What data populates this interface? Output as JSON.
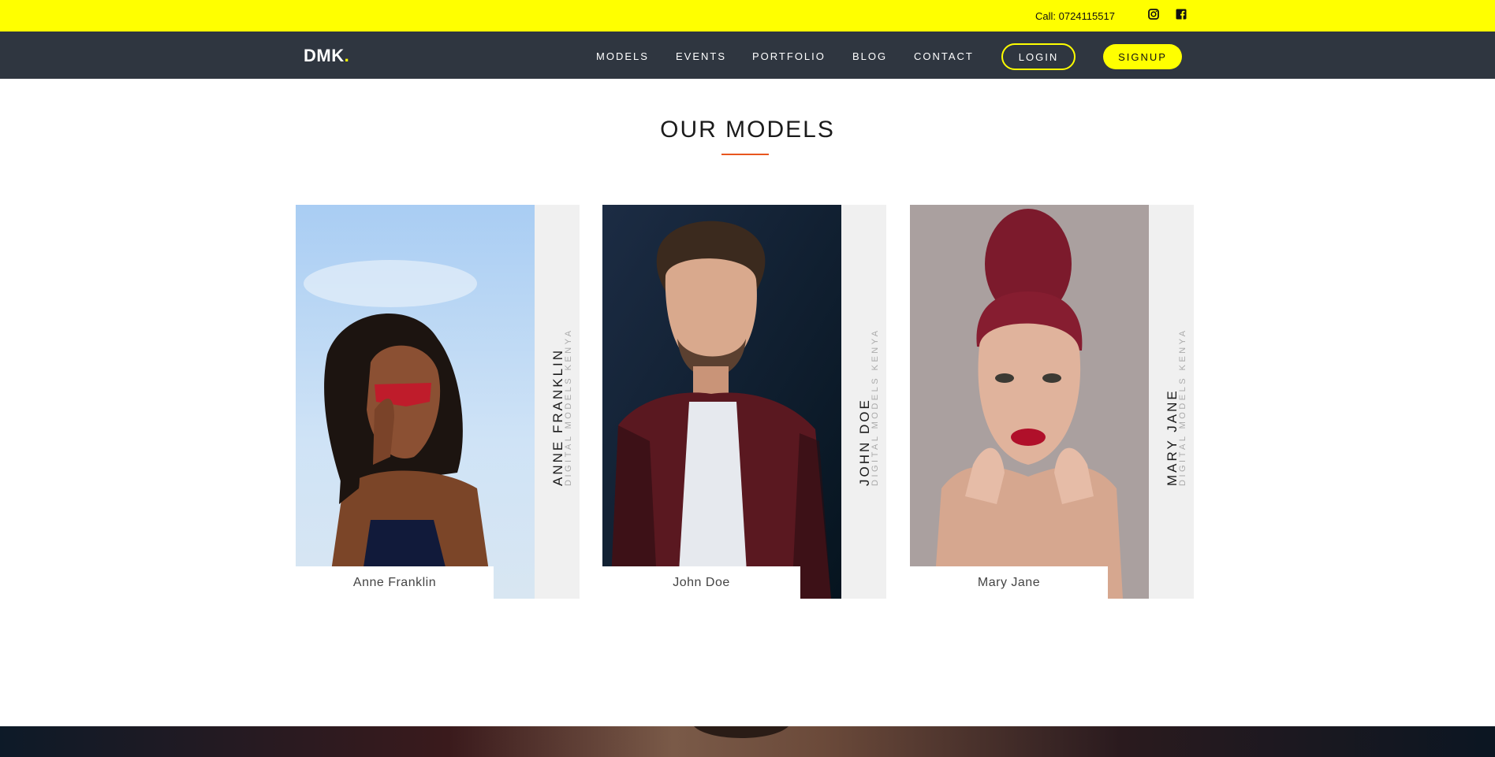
{
  "topbar": {
    "call_text": "Call: 0724115517",
    "icons": [
      "instagram-icon",
      "facebook-icon"
    ],
    "background": "#ffff00"
  },
  "nav": {
    "logo_text": "DMK",
    "logo_dot": ".",
    "links": [
      "MODELS",
      "EVENTS",
      "PORTFOLIO",
      "BLOG",
      "CONTACT"
    ],
    "login_label": "LOGIN",
    "signup_label": "SIGNUP",
    "background": "#2f3640",
    "accent": "#ffff00"
  },
  "section": {
    "title": "OUR MODELS",
    "underline_color": "#e8561e"
  },
  "models": [
    {
      "name": "Anne Franklin",
      "vertical_name": "ANNE FRANKLIN",
      "tagline": "DIGITAL MODELS KENYA"
    },
    {
      "name": "John Doe",
      "vertical_name": "JOHN DOE",
      "tagline": "DIGITAL MODELS KENYA"
    },
    {
      "name": "Mary Jane",
      "vertical_name": "MARY JANE",
      "tagline": "DIGITAL MODELS KENYA"
    }
  ]
}
